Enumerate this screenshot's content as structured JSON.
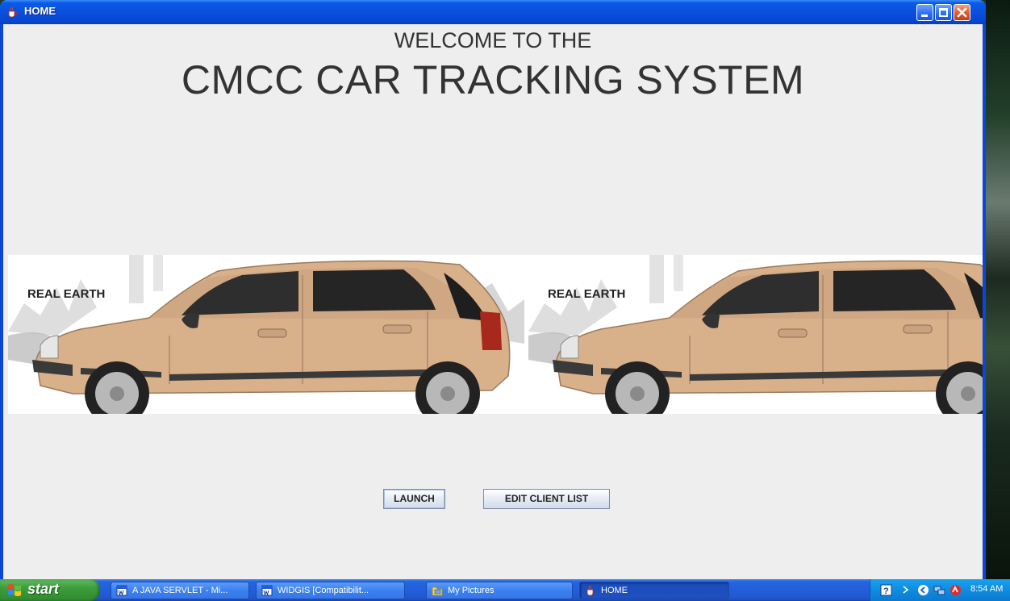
{
  "window": {
    "title": "HOME",
    "icon": "java-cup-icon"
  },
  "app": {
    "welcome_line": "WELCOME TO THE",
    "title_line": "CMCC CAR TRACKING SYSTEM",
    "banner": {
      "left_label": "REAL EARTH",
      "right_label": "REAL EARTH",
      "car_color": "#d8b08a"
    },
    "buttons": {
      "launch": "LAUNCH",
      "edit_client_list": "EDIT CLIENT LIST"
    }
  },
  "taskbar": {
    "start_label": "start",
    "items": [
      {
        "label": "A JAVA SERVLET - Mi...",
        "icon": "word-document-icon"
      },
      {
        "label": "WIDGIS [Compatibilit...",
        "icon": "word-document-icon"
      },
      {
        "label": "My Pictures",
        "icon": "folder-icon"
      },
      {
        "label": "HOME",
        "icon": "java-cup-icon"
      }
    ],
    "clock": "8:54 AM"
  },
  "colors": {
    "titlebar": "#0a4fdd",
    "client_bg": "#eeeeee",
    "taskbar": "#245edb",
    "start_button": "#3c9d3c",
    "tray": "#0f8ce0"
  }
}
